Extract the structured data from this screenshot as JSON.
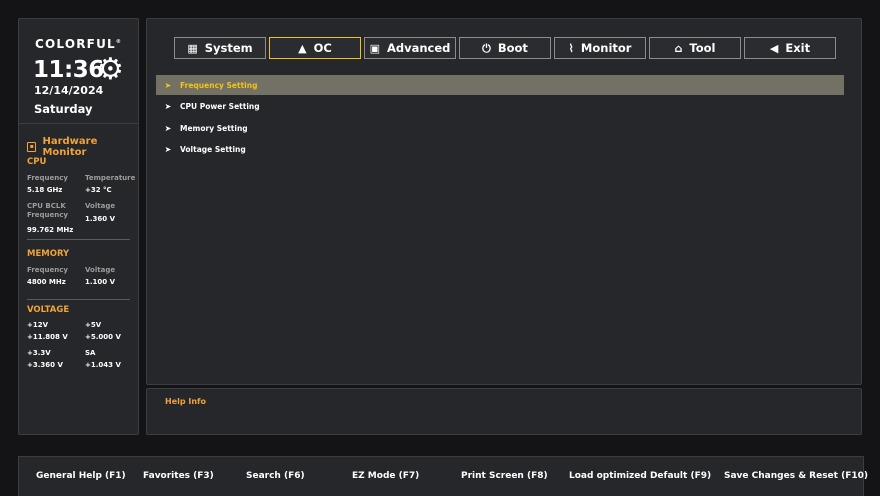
{
  "brand": {
    "name": "COLORFUL",
    "time": "11:36",
    "date": "12/14/2024",
    "day": "Saturday"
  },
  "hardware_monitor": {
    "title": "Hardware Monitor",
    "cpu": {
      "title": "CPU",
      "frequency_label": "Frequency",
      "frequency_value": "5.18 GHz",
      "temperature_label": "Temperature",
      "temperature_value": "+32 °C",
      "bclk_label_1": "CPU BCLK",
      "bclk_label_2": "Frequency",
      "bclk_value": "99.762 MHz",
      "voltage_label": "Voltage",
      "voltage_value": "1.360 V"
    },
    "memory": {
      "title": "MEMORY",
      "frequency_label": "Frequency",
      "frequency_value": "4800 MHz",
      "voltage_label": "Voltage",
      "voltage_value": "1.100 V"
    },
    "voltage": {
      "title": "VOLTAGE",
      "v12_label": "+12V",
      "v12_value": "+11.808 V",
      "v5_label": "+5V",
      "v5_value": "+5.000 V",
      "v33_label": "+3.3V",
      "v33_value": "+3.360 V",
      "sa_label": "SA",
      "sa_value": "+1.043 V"
    }
  },
  "tabs": [
    {
      "label": "System",
      "icon": "grid-icon"
    },
    {
      "label": "OC",
      "icon": "rocket-icon"
    },
    {
      "label": "Advanced",
      "icon": "chip-icon"
    },
    {
      "label": "Boot",
      "icon": "power-icon"
    },
    {
      "label": "Monitor",
      "icon": "pulse-icon"
    },
    {
      "label": "Tool",
      "icon": "toolbox-icon"
    },
    {
      "label": "Exit",
      "icon": "back-arrow-icon"
    }
  ],
  "active_tab": "OC",
  "menu_items": [
    {
      "label": "Frequency Setting",
      "selected": true
    },
    {
      "label": "CPU Power Setting",
      "selected": false
    },
    {
      "label": "Memory Setting",
      "selected": false
    },
    {
      "label": "Voltage Setting",
      "selected": false
    }
  ],
  "help": {
    "title": "Help Info"
  },
  "footer": [
    {
      "label": "General Help (F1)"
    },
    {
      "label": "Favorites (F3)"
    },
    {
      "label": "Search (F6)"
    },
    {
      "label": "EZ Mode (F7)"
    },
    {
      "label": "Print Screen (F8)"
    },
    {
      "label": "Load optimized Default (F9)"
    },
    {
      "label": "Save Changes & Reset (F10)"
    }
  ],
  "colors": {
    "accent": "#f2c318",
    "section_title": "#f0a33a",
    "selected_row": "#737164",
    "panel": "#26272a",
    "background": "#141416"
  }
}
